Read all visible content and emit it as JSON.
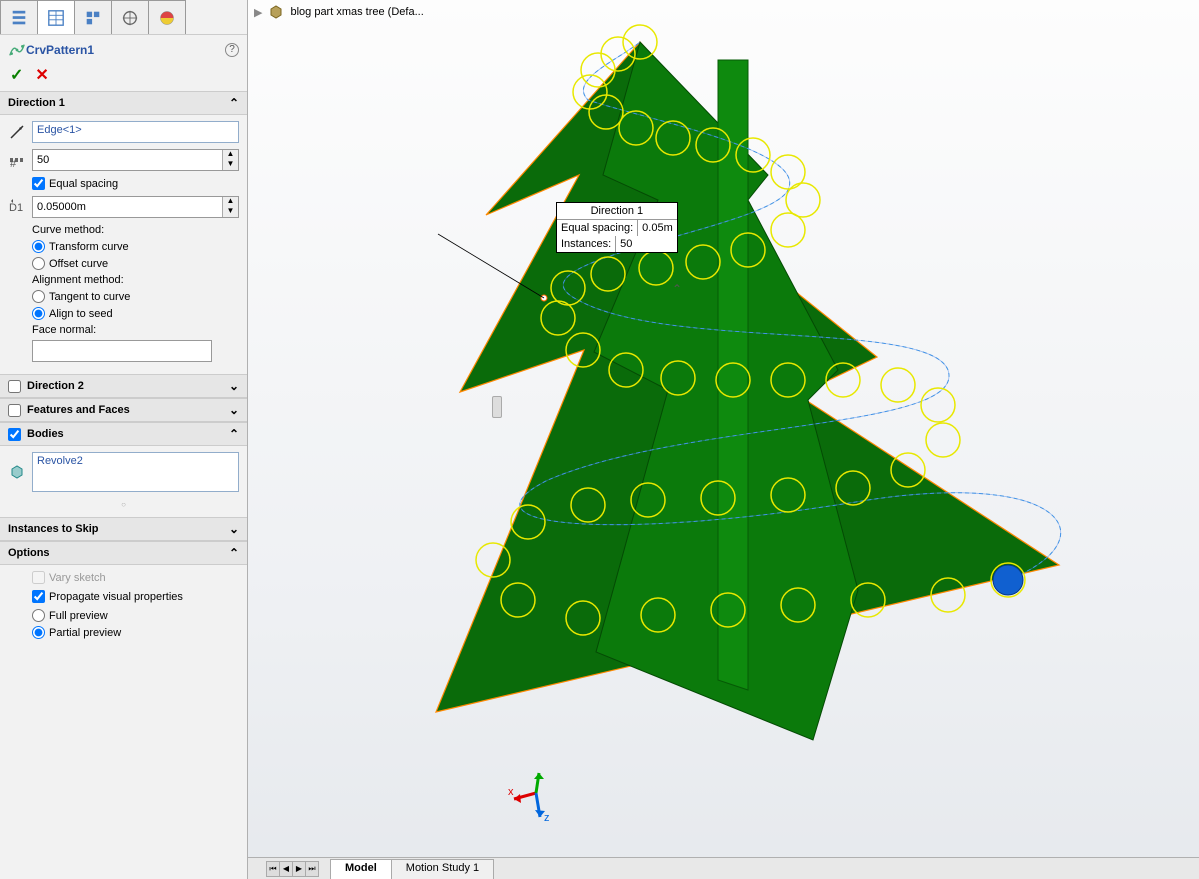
{
  "breadcrumb": {
    "text": "blog part xmas tree  (Defa..."
  },
  "feature": {
    "name": "CrvPattern1"
  },
  "direction1": {
    "title": "Direction 1",
    "edge": "Edge<1>",
    "instances": "50",
    "equal_spacing": "Equal spacing",
    "spacing_value": "0.05000m",
    "curve_method_label": "Curve method:",
    "transform_curve": "Transform curve",
    "offset_curve": "Offset curve",
    "alignment_method_label": "Alignment method:",
    "tangent_to_curve": "Tangent to curve",
    "align_to_seed": "Align to seed",
    "face_normal_label": "Face normal:"
  },
  "sections": {
    "direction2": "Direction 2",
    "features_faces": "Features and Faces",
    "bodies": "Bodies",
    "instances_skip": "Instances to Skip",
    "options": "Options"
  },
  "bodies": {
    "item": "Revolve2"
  },
  "options": {
    "vary_sketch": "Vary sketch",
    "propagate": "Propagate visual properties",
    "full_preview": "Full preview",
    "partial_preview": "Partial preview"
  },
  "callout": {
    "title": "Direction 1",
    "row1_label": "Equal spacing:",
    "row1_value": "0.05m",
    "row2_label": "Instances:",
    "row2_value": "50"
  },
  "bottomtabs": {
    "model": "Model",
    "motion": "Motion Study 1"
  }
}
